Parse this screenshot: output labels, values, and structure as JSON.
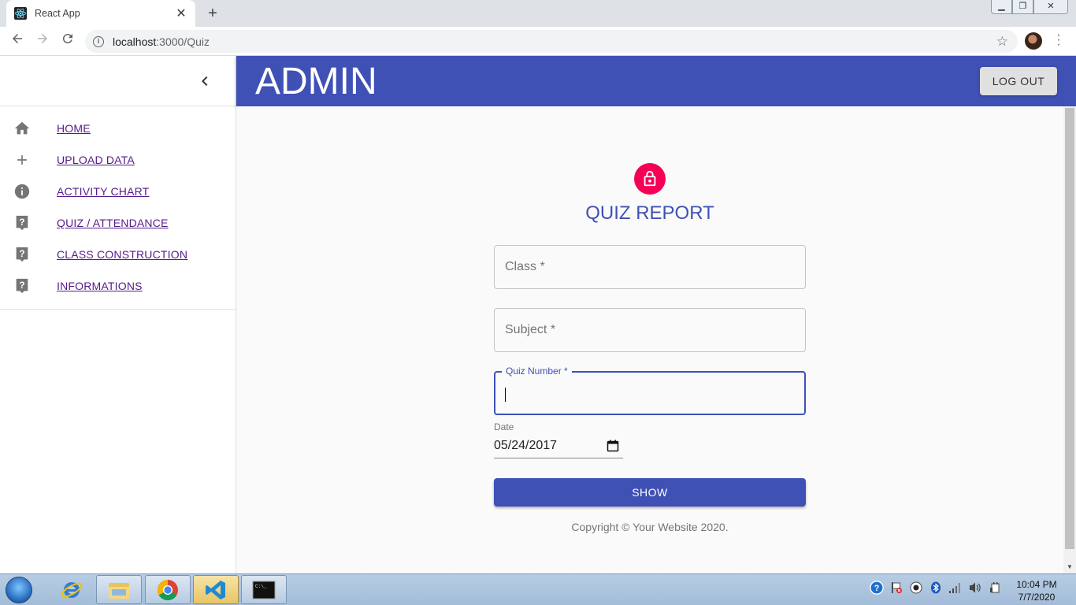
{
  "browser": {
    "tab_title": "React App",
    "tab_close": "✕",
    "new_tab": "+",
    "url_host": "localhost",
    "url_path": ":3000/Quiz"
  },
  "sidebar": {
    "items": [
      {
        "label": "HOME",
        "icon": "home-icon"
      },
      {
        "label": "UPLOAD DATA",
        "icon": "plus-icon"
      },
      {
        "label": "ACTIVITY CHART",
        "icon": "info-icon"
      },
      {
        "label": "QUIZ / ATTENDANCE",
        "icon": "help-icon"
      },
      {
        "label": "CLASS CONSTRUCTION",
        "icon": "help-icon"
      },
      {
        "label": "INFORMATIONS",
        "icon": "help-icon"
      }
    ]
  },
  "appbar": {
    "title": "ADMIN",
    "logout_label": "LOG OUT"
  },
  "form": {
    "title": "QUIZ REPORT",
    "class_label": "Class *",
    "subject_label": "Subject *",
    "quiz_number_label": "Quiz Number *",
    "date_label": "Date",
    "date_value": "05/24/2017",
    "submit_label": "SHOW",
    "copyright": "Copyright © Your Website 2020."
  },
  "taskbar": {
    "time": "10:04 PM",
    "date": "7/7/2020"
  },
  "colors": {
    "primary": "#3f51b5",
    "secondary": "#f50057",
    "link": "#551a8b"
  }
}
